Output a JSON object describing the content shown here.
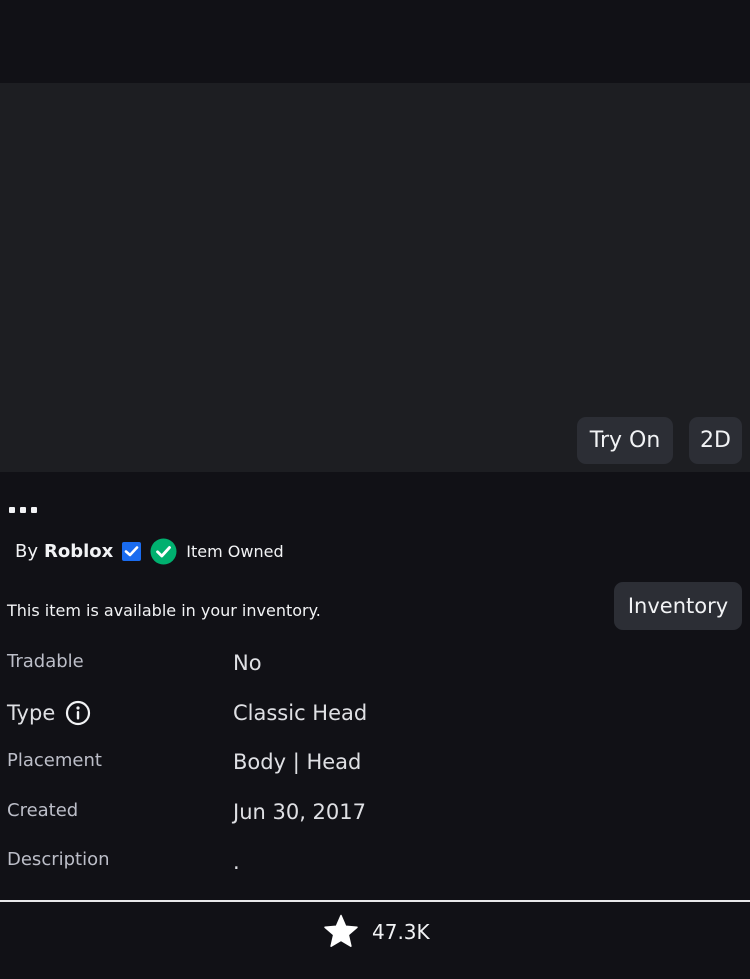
{
  "preview": {
    "try_on_label": "Try On",
    "view_2d_label": "2D"
  },
  "item": {
    "more_label": "...",
    "by_prefix": "By",
    "creator": "Roblox",
    "owned_label": "Item Owned",
    "inventory_message": "This item is available in your inventory.",
    "inventory_button": "Inventory"
  },
  "details": {
    "tradable_label": "Tradable",
    "tradable_value": "No",
    "type_label": "Type",
    "type_value": "Classic Head",
    "placement_label": "Placement",
    "placement_value": "Body | Head",
    "created_label": "Created",
    "created_value": "Jun 30, 2017",
    "description_label": "Description",
    "description_value": "."
  },
  "footer": {
    "favorite_count": "47.3K"
  },
  "icons": {
    "verified": "verified-badge-icon",
    "owned": "check-circle-icon",
    "info": "info-icon",
    "favorite": "star-icon"
  },
  "colors": {
    "background": "#111116",
    "preview_background": "#1d1e22",
    "button_background": "#2c2e35",
    "verified_blue": "#1a6cf0",
    "owned_green": "#00b06f"
  }
}
